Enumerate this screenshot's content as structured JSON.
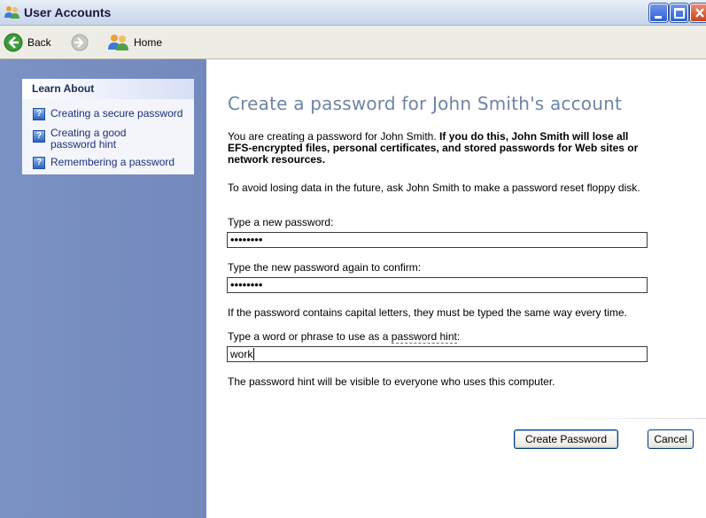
{
  "window": {
    "title": "User Accounts"
  },
  "toolbar": {
    "back_label": "Back",
    "home_label": "Home"
  },
  "sidebar": {
    "learn_about_heading": "Learn About",
    "items": [
      {
        "label": "Creating a secure password"
      },
      {
        "label": "Creating a good password hint"
      },
      {
        "label": "Remembering a password"
      }
    ]
  },
  "main": {
    "title": "Create a password for John Smith's account",
    "intro_normal": "You are creating a password for John Smith. ",
    "intro_bold": "If you do this, John Smith will lose all EFS-encrypted files, personal certificates, and stored passwords for Web sites or network resources.",
    "reset_note": "To avoid losing data in the future, ask John Smith to make a password reset floppy disk.",
    "new_password_label": "Type a new password:",
    "new_password_value": "••••••••",
    "confirm_label": "Type the new password again to confirm:",
    "confirm_value": "••••••••",
    "capital_note": "If the password contains capital letters, they must be typed the same way every time.",
    "hint_label_prefix": "Type a word or phrase to use as a ",
    "hint_label_link": "password hint",
    "hint_label_suffix": ":",
    "hint_value": "work",
    "hint_visibility_note": "The password hint will be visible to everyone who uses this computer.",
    "create_button": "Create Password",
    "cancel_button": "Cancel"
  }
}
